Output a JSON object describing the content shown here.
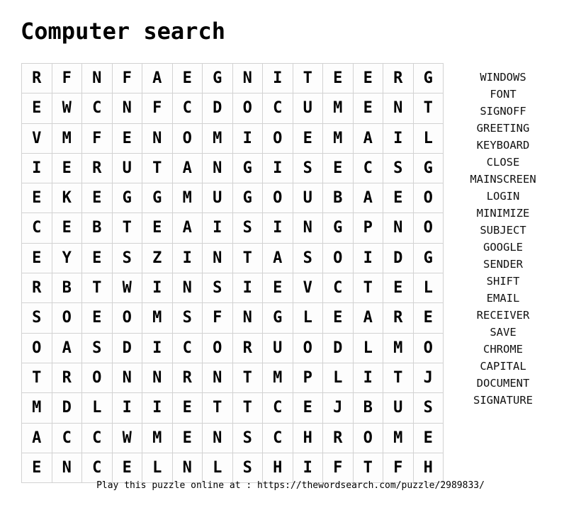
{
  "page": {
    "title": "Computer search",
    "footer_note": "Play this puzzle online at : https://thewordsearch.com/puzzle/2989833/",
    "background_color": "#ffffff",
    "text_color": "#000000",
    "grid_line_color": "#d2d2d2"
  },
  "grid": {
    "rows": 14,
    "cols": 14,
    "letters": [
      [
        "R",
        "F",
        "N",
        "F",
        "A",
        "E",
        "G",
        "N",
        "I",
        "T",
        "E",
        "E",
        "R",
        "G"
      ],
      [
        "E",
        "W",
        "C",
        "N",
        "F",
        "C",
        "D",
        "O",
        "C",
        "U",
        "M",
        "E",
        "N",
        "T"
      ],
      [
        "V",
        "M",
        "F",
        "E",
        "N",
        "O",
        "M",
        "I",
        "O",
        "E",
        "M",
        "A",
        "I",
        "L"
      ],
      [
        "I",
        "E",
        "R",
        "U",
        "T",
        "A",
        "N",
        "G",
        "I",
        "S",
        "E",
        "C",
        "S",
        "G"
      ],
      [
        "E",
        "K",
        "E",
        "G",
        "G",
        "M",
        "U",
        "G",
        "O",
        "U",
        "B",
        "A",
        "E",
        "O"
      ],
      [
        "C",
        "E",
        "B",
        "T",
        "E",
        "A",
        "I",
        "S",
        "I",
        "N",
        "G",
        "P",
        "N",
        "O"
      ],
      [
        "E",
        "Y",
        "E",
        "S",
        "Z",
        "I",
        "N",
        "T",
        "A",
        "S",
        "O",
        "I",
        "D",
        "G"
      ],
      [
        "R",
        "B",
        "T",
        "W",
        "I",
        "N",
        "S",
        "I",
        "E",
        "V",
        "C",
        "T",
        "E",
        "L"
      ],
      [
        "S",
        "O",
        "E",
        "O",
        "M",
        "S",
        "F",
        "N",
        "G",
        "L",
        "E",
        "A",
        "R",
        "E"
      ],
      [
        "O",
        "A",
        "S",
        "D",
        "I",
        "C",
        "O",
        "R",
        "U",
        "O",
        "D",
        "L",
        "M",
        "O"
      ],
      [
        "T",
        "R",
        "O",
        "N",
        "N",
        "R",
        "N",
        "T",
        "M",
        "P",
        "L",
        "I",
        "T",
        "J"
      ],
      [
        "M",
        "D",
        "L",
        "I",
        "I",
        "E",
        "T",
        "T",
        "C",
        "E",
        "J",
        "B",
        "U",
        "S"
      ],
      [
        "A",
        "C",
        "C",
        "W",
        "M",
        "E",
        "N",
        "S",
        "C",
        "H",
        "R",
        "O",
        "M",
        "E"
      ],
      [
        "E",
        "N",
        "C",
        "E",
        "L",
        "N",
        "L",
        "S",
        "H",
        "I",
        "F",
        "T",
        "F",
        "H"
      ]
    ]
  },
  "word_list": {
    "words": [
      "WINDOWS",
      "FONT",
      "SIGNOFF",
      "GREETING",
      "KEYBOARD",
      "CLOSE",
      "MAINSCREEN",
      "LOGIN",
      "MINIMIZE",
      "SUBJECT",
      "GOOGLE",
      "SENDER",
      "SHIFT",
      "EMAIL",
      "RECEIVER",
      "SAVE",
      "CHROME",
      "CAPITAL",
      "DOCUMENT",
      "SIGNATURE"
    ]
  }
}
